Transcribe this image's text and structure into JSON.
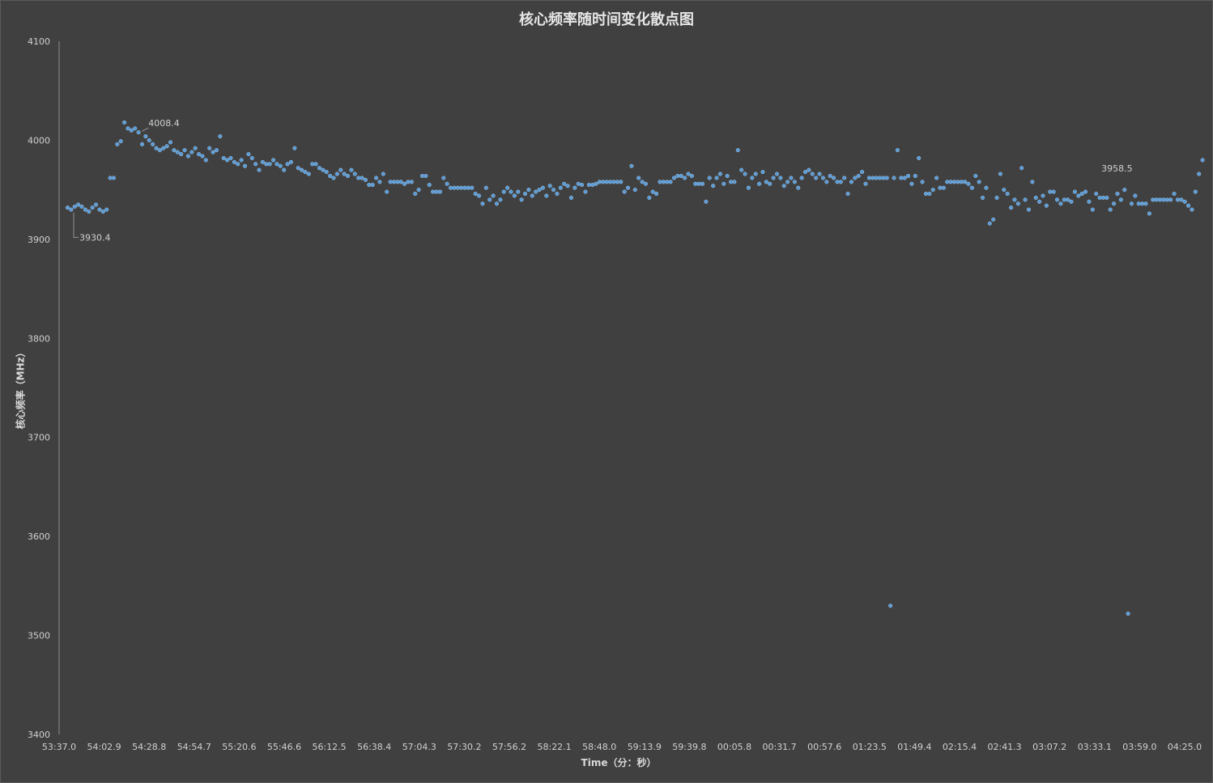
{
  "chart_data": {
    "type": "scatter",
    "title": "核心频率随时间变化散点图",
    "xlabel": "Time（分：秒）",
    "ylabel": "核心频率（MHz）",
    "ylim": [
      3400,
      4100
    ],
    "yticks": [
      "4100",
      "4000",
      "3900",
      "3800",
      "3700",
      "3600",
      "3500",
      "3400"
    ],
    "xticks": [
      "53:37.0",
      "54:02.9",
      "54:28.8",
      "54:54.7",
      "55:20.6",
      "55:46.6",
      "56:12.5",
      "56:38.4",
      "57:04.3",
      "57:30.2",
      "57:56.2",
      "58:22.1",
      "58:48.0",
      "59:13.9",
      "59:39.8",
      "00:05.8",
      "00:31.7",
      "00:57.6",
      "01:23.5",
      "01:49.4",
      "02:15.4",
      "02:41.3",
      "03:07.2",
      "03:33.1",
      "03:59.0",
      "04:25.0"
    ],
    "grid": false,
    "legend": "none",
    "marker_color": "#5b9bd5",
    "annotations": [
      {
        "text": "3930.4",
        "x": 0.8,
        "y": 3930.4
      },
      {
        "text": "4008.4",
        "x": 20.5,
        "y": 4008.4
      },
      {
        "text": "3958.5",
        "x": 296.5,
        "y": 3958.5
      }
    ],
    "series": [
      {
        "values": [
          3932,
          3930,
          3933,
          3935,
          3933,
          3930,
          3928,
          3932,
          3935,
          3930,
          3928,
          3930,
          3962,
          3962,
          3996,
          3999,
          4018,
          4012,
          4010,
          4012,
          4008,
          3996,
          4004,
          4000,
          3996,
          3992,
          3990,
          3992,
          3994,
          3998,
          3990,
          3988,
          3986,
          3990,
          3984,
          3988,
          3992,
          3986,
          3984,
          3980,
          3992,
          3988,
          3990,
          4004,
          3982,
          3980,
          3982,
          3978,
          3976,
          3980,
          3974,
          3986,
          3982,
          3976,
          3970,
          3978,
          3976,
          3976,
          3980,
          3976,
          3974,
          3970,
          3976,
          3978,
          3992,
          3972,
          3970,
          3968,
          3966,
          3976,
          3976,
          3972,
          3970,
          3968,
          3964,
          3962,
          3966,
          3970,
          3966,
          3964,
          3970,
          3966,
          3962,
          3962,
          3960,
          3955,
          3955,
          3962,
          3958,
          3966,
          3948,
          3958,
          3958,
          3958,
          3958,
          3956,
          3958,
          3958,
          3946,
          3950,
          3964,
          3964,
          3955,
          3948,
          3948,
          3948,
          3962,
          3956,
          3952,
          3952,
          3952,
          3952,
          3952,
          3952,
          3952,
          3946,
          3944,
          3936,
          3952,
          3940,
          3944,
          3936,
          3940,
          3948,
          3952,
          3948,
          3944,
          3948,
          3940,
          3946,
          3950,
          3944,
          3948,
          3950,
          3952,
          3944,
          3954,
          3950,
          3946,
          3952,
          3956,
          3954,
          3942,
          3952,
          3956,
          3955,
          3948,
          3955,
          3955,
          3956,
          3958,
          3958,
          3958,
          3958,
          3958,
          3958,
          3958,
          3948,
          3952,
          3974,
          3950,
          3962,
          3958,
          3956,
          3942,
          3948,
          3946,
          3958,
          3958,
          3958,
          3958,
          3962,
          3964,
          3964,
          3962,
          3966,
          3964,
          3956,
          3956,
          3956,
          3938,
          3962,
          3954,
          3962,
          3966,
          3956,
          3964,
          3958,
          3958,
          3990,
          3970,
          3966,
          3952,
          3962,
          3966,
          3956,
          3968,
          3958,
          3956,
          3962,
          3966,
          3962,
          3954,
          3958,
          3962,
          3958,
          3952,
          3962,
          3968,
          3970,
          3966,
          3962,
          3966,
          3962,
          3958,
          3964,
          3962,
          3958,
          3958,
          3962,
          3946,
          3958,
          3962,
          3964,
          3968,
          3956,
          3962,
          3962,
          3962,
          3962,
          3962,
          3962,
          3530,
          3962,
          3990,
          3962,
          3962,
          3964,
          3956,
          3964,
          3982,
          3958,
          3946,
          3946,
          3950,
          3962,
          3952,
          3952,
          3958,
          3958,
          3958,
          3958,
          3958,
          3958,
          3956,
          3952,
          3964,
          3958,
          3942,
          3952,
          3916,
          3920,
          3942,
          3966,
          3950,
          3946,
          3932,
          3940,
          3936,
          3972,
          3940,
          3930,
          3958,
          3942,
          3938,
          3944,
          3934,
          3948,
          3948,
          3940,
          3936,
          3940,
          3940,
          3938,
          3948,
          3944,
          3946,
          3948,
          3938,
          3930,
          3946,
          3942,
          3942,
          3942,
          3930,
          3936,
          3946,
          3940,
          3950,
          3522,
          3936,
          3944,
          3936,
          3936,
          3936,
          3926,
          3940,
          3940,
          3940,
          3940,
          3940,
          3940,
          3946,
          3940,
          3940,
          3938,
          3934,
          3930,
          3948,
          3966,
          3980
        ]
      }
    ]
  }
}
